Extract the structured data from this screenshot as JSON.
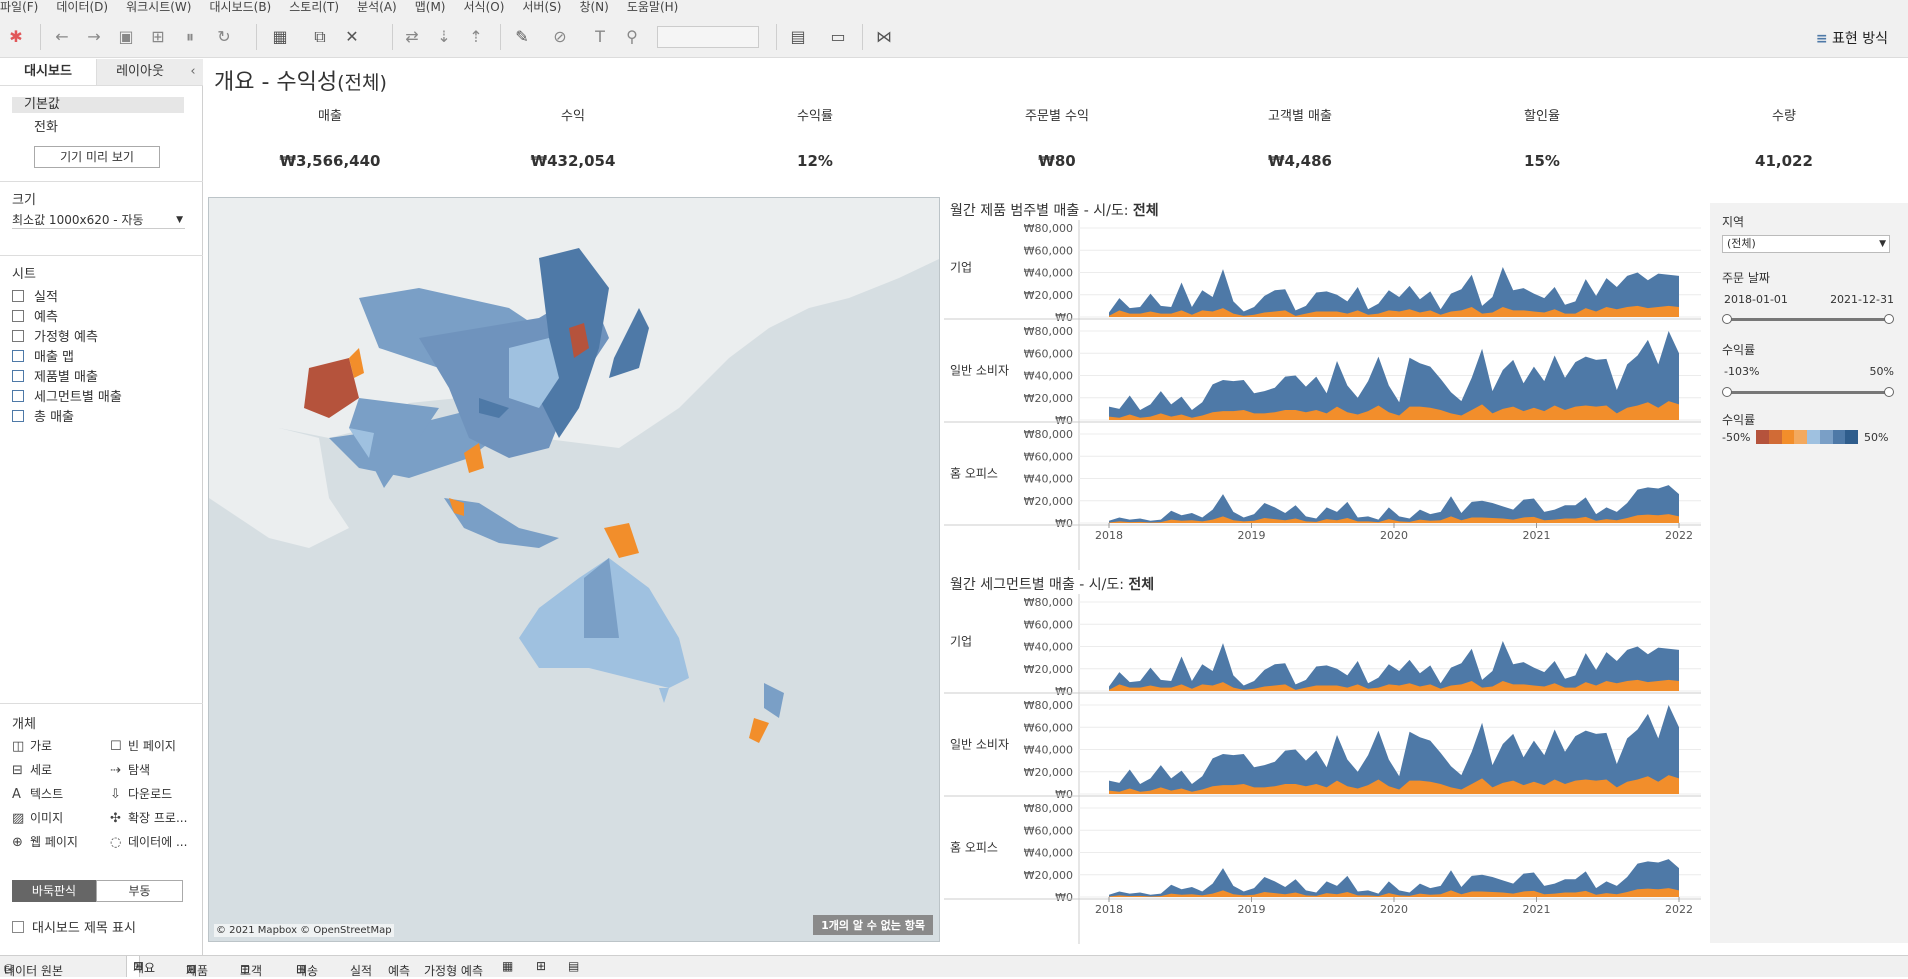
{
  "menu": [
    "파일(F)",
    "데이터(D)",
    "워크시트(W)",
    "대시보드(B)",
    "스토리(T)",
    "분석(A)",
    "맵(M)",
    "서식(O)",
    "서버(S)",
    "창(N)",
    "도움말(H)"
  ],
  "toolbar": {
    "show_me": "표현 방식"
  },
  "left_panel": {
    "tab_dashboard": "대시보드",
    "tab_layout": "레이아웃",
    "device_default": "기본값",
    "device_phone": "전화",
    "preview_button": "기기 미리 보기",
    "size_label": "크기",
    "size_value": "최소값 1000x620 - 자동",
    "sheets_label": "시트",
    "sheets": [
      "실적",
      "예측",
      "가정형 예측",
      "매출 맵",
      "제품별 매출",
      "세그먼트별 매출",
      "총 매출"
    ],
    "objects_label": "개체",
    "objects": [
      "가로",
      "빈 페이지",
      "세로",
      "탐색",
      "텍스트",
      "다운로드",
      "이미지",
      "확장 프로...",
      "웹 페이지",
      "데이터에 ..."
    ],
    "tiled": "바둑판식",
    "floating": "부동",
    "show_title": "대시보드 제목 표시"
  },
  "dashboard": {
    "title": "개요 - 수익성",
    "title_suffix": "(전체)",
    "kpis": [
      {
        "label": "매출",
        "value": "₩3,566,440"
      },
      {
        "label": "수익",
        "value": "₩432,054"
      },
      {
        "label": "수익률",
        "value": "12%"
      },
      {
        "label": "주문별 수익",
        "value": "₩80"
      },
      {
        "label": "고객별 매출",
        "value": "₩4,486"
      },
      {
        "label": "할인율",
        "value": "15%"
      },
      {
        "label": "수량",
        "value": "41,022"
      }
    ]
  },
  "map": {
    "attribution": "© 2021 Mapbox © OpenStreetMap",
    "unknown_badge": "1개의 알 수 없는 항목",
    "colors": {
      "sea": "#d6dee2",
      "land": "#ebeeef",
      "blue_dark": "#4e79a7",
      "blue_mid": "#7a9fc6",
      "blue_light": "#9fc1e0",
      "orange": "#f28e2b",
      "red": "#b5533c"
    }
  },
  "chart1": {
    "title": "월간 제품 범주별 매출 - 시/도: ",
    "title_bold": "전체"
  },
  "chart2": {
    "title": "월간 세그먼트별 매출 - 시/도: ",
    "title_bold": "전체"
  },
  "chart_data": [
    {
      "type": "area",
      "title": "월간 제품 범주별 매출 - 시/도: 전체",
      "rows": [
        "기업",
        "일반 소비자",
        "홈 오피스"
      ],
      "x_range": [
        "2018",
        "2022"
      ],
      "x_ticks": [
        "2018",
        "2019",
        "2020",
        "2021",
        "2022"
      ],
      "y_ticks": [
        "₩0",
        "₩20,000",
        "₩40,000",
        "₩60,000",
        "₩80,000"
      ],
      "ylim": [
        0,
        80000
      ],
      "series_colors": {
        "top": "#4e79a7",
        "bottom": "#f28e2b"
      },
      "series": [
        {
          "row": "기업",
          "top": [
            4000,
            17000,
            8000,
            9000,
            21000,
            10000,
            9000,
            31000,
            9000,
            24000,
            18000,
            43000,
            14000,
            5000,
            9000,
            19000,
            24000,
            25000,
            6000,
            10000,
            22000,
            23000,
            20000,
            14000,
            27000,
            7000,
            12000,
            24000,
            18000,
            28000,
            16000,
            23000,
            7000,
            21000,
            25000,
            38000,
            10000,
            18000,
            45000,
            24000,
            26000,
            21000,
            17000,
            27000,
            11000,
            14000,
            34000,
            19000,
            35000,
            27000,
            37000,
            40000,
            33000,
            39000,
            38000,
            37000
          ],
          "bottom": [
            1000,
            6000,
            3000,
            3000,
            5000,
            3000,
            3000,
            6000,
            2000,
            6000,
            5000,
            8000,
            3000,
            1000,
            2000,
            4000,
            5000,
            6000,
            1000,
            3000,
            5000,
            5000,
            5000,
            3000,
            6000,
            2000,
            3000,
            6000,
            5000,
            7000,
            4000,
            6000,
            2000,
            5000,
            6000,
            9000,
            3000,
            4000,
            9000,
            6000,
            6000,
            5000,
            4000,
            7000,
            3000,
            3000,
            8000,
            5000,
            9000,
            7000,
            9000,
            10000,
            8000,
            9000,
            10000,
            9000
          ]
        },
        {
          "row": "일반 소비자",
          "top": [
            12000,
            10000,
            22000,
            9000,
            14000,
            26000,
            14000,
            21000,
            9000,
            16000,
            32000,
            36000,
            35000,
            36000,
            24000,
            26000,
            29000,
            39000,
            40000,
            30000,
            39000,
            24000,
            53000,
            31000,
            20000,
            35000,
            57000,
            31000,
            16000,
            56000,
            51000,
            48000,
            37000,
            25000,
            17000,
            38000,
            64000,
            26000,
            45000,
            54000,
            33000,
            48000,
            35000,
            58000,
            38000,
            52000,
            57000,
            54000,
            55000,
            27000,
            50000,
            58000,
            72000,
            50000,
            80000,
            60000
          ],
          "bottom": [
            3000,
            2000,
            5000,
            2000,
            3000,
            6000,
            3000,
            5000,
            2000,
            4000,
            7000,
            8000,
            8000,
            9000,
            6000,
            6000,
            7000,
            9000,
            9000,
            7000,
            9000,
            6000,
            12000,
            7000,
            5000,
            8000,
            13000,
            7000,
            4000,
            12000,
            12000,
            11000,
            9000,
            6000,
            4000,
            9000,
            14000,
            6000,
            10000,
            12000,
            8000,
            11000,
            8000,
            13000,
            9000,
            12000,
            13000,
            12000,
            13000,
            6000,
            11000,
            13000,
            16000,
            11000,
            17000,
            14000
          ]
        },
        {
          "row": "홈 오피스",
          "top": [
            2000,
            5000,
            3000,
            4000,
            2000,
            3000,
            11000,
            7000,
            9000,
            5000,
            12000,
            26000,
            10000,
            5000,
            8000,
            18000,
            14000,
            9000,
            16000,
            6000,
            4000,
            14000,
            10000,
            19000,
            5000,
            6000,
            3000,
            14000,
            6000,
            4000,
            12000,
            8000,
            10000,
            24000,
            9000,
            19000,
            20000,
            18000,
            15000,
            12000,
            21000,
            22000,
            10000,
            12000,
            16000,
            16000,
            23000,
            8000,
            14000,
            10000,
            18000,
            30000,
            32000,
            31000,
            34000,
            26000
          ],
          "bottom": [
            500,
            1500,
            800,
            1000,
            500,
            800,
            3000,
            2000,
            2500,
            1500,
            3000,
            6000,
            2500,
            1500,
            2000,
            4500,
            3500,
            2500,
            4000,
            1500,
            1000,
            3500,
            2500,
            4500,
            1500,
            1500,
            800,
            3500,
            1500,
            1000,
            3000,
            2000,
            2500,
            6000,
            2500,
            5000,
            5000,
            4500,
            4000,
            3000,
            5000,
            5500,
            2500,
            3000,
            4000,
            4000,
            5500,
            2000,
            3500,
            2500,
            4500,
            7000,
            7500,
            7000,
            8000,
            6000
          ]
        }
      ]
    },
    {
      "type": "area",
      "title": "월간 세그먼트별 매출 - 시/도: 전체",
      "rows": [
        "기업",
        "일반 소비자",
        "홈 오피스"
      ],
      "x_range": [
        "2018",
        "2022"
      ],
      "x_ticks": [
        "2018",
        "2019",
        "2020",
        "2021",
        "2022"
      ],
      "y_ticks": [
        "₩0",
        "₩20,000",
        "₩40,000",
        "₩60,000",
        "₩80,000"
      ],
      "ylim": [
        0,
        80000
      ],
      "series_colors": {
        "top": "#4e79a7",
        "bottom": "#f28e2b"
      },
      "same_as_first": true
    }
  ],
  "filters": {
    "region_label": "지역",
    "region_value": "(전체)",
    "date_label": "주문 날짜",
    "date_start": "2018-01-01",
    "date_end": "2021-12-31",
    "profit_label": "수익률",
    "profit_min": "-103%",
    "profit_max": "50%",
    "legend_label": "수익률",
    "legend_min": "-50%",
    "legend_max": "50%",
    "legend_colors": [
      "#b5533c",
      "#d16b36",
      "#f28e2b",
      "#f3a95e",
      "#9fc1e0",
      "#7a9fc6",
      "#4e79a7",
      "#2f5d8c"
    ]
  },
  "tabs": [
    "데이터 원본",
    "개요",
    "제품",
    "고객",
    "배송",
    "실적",
    "예측",
    "가정형 예측"
  ]
}
